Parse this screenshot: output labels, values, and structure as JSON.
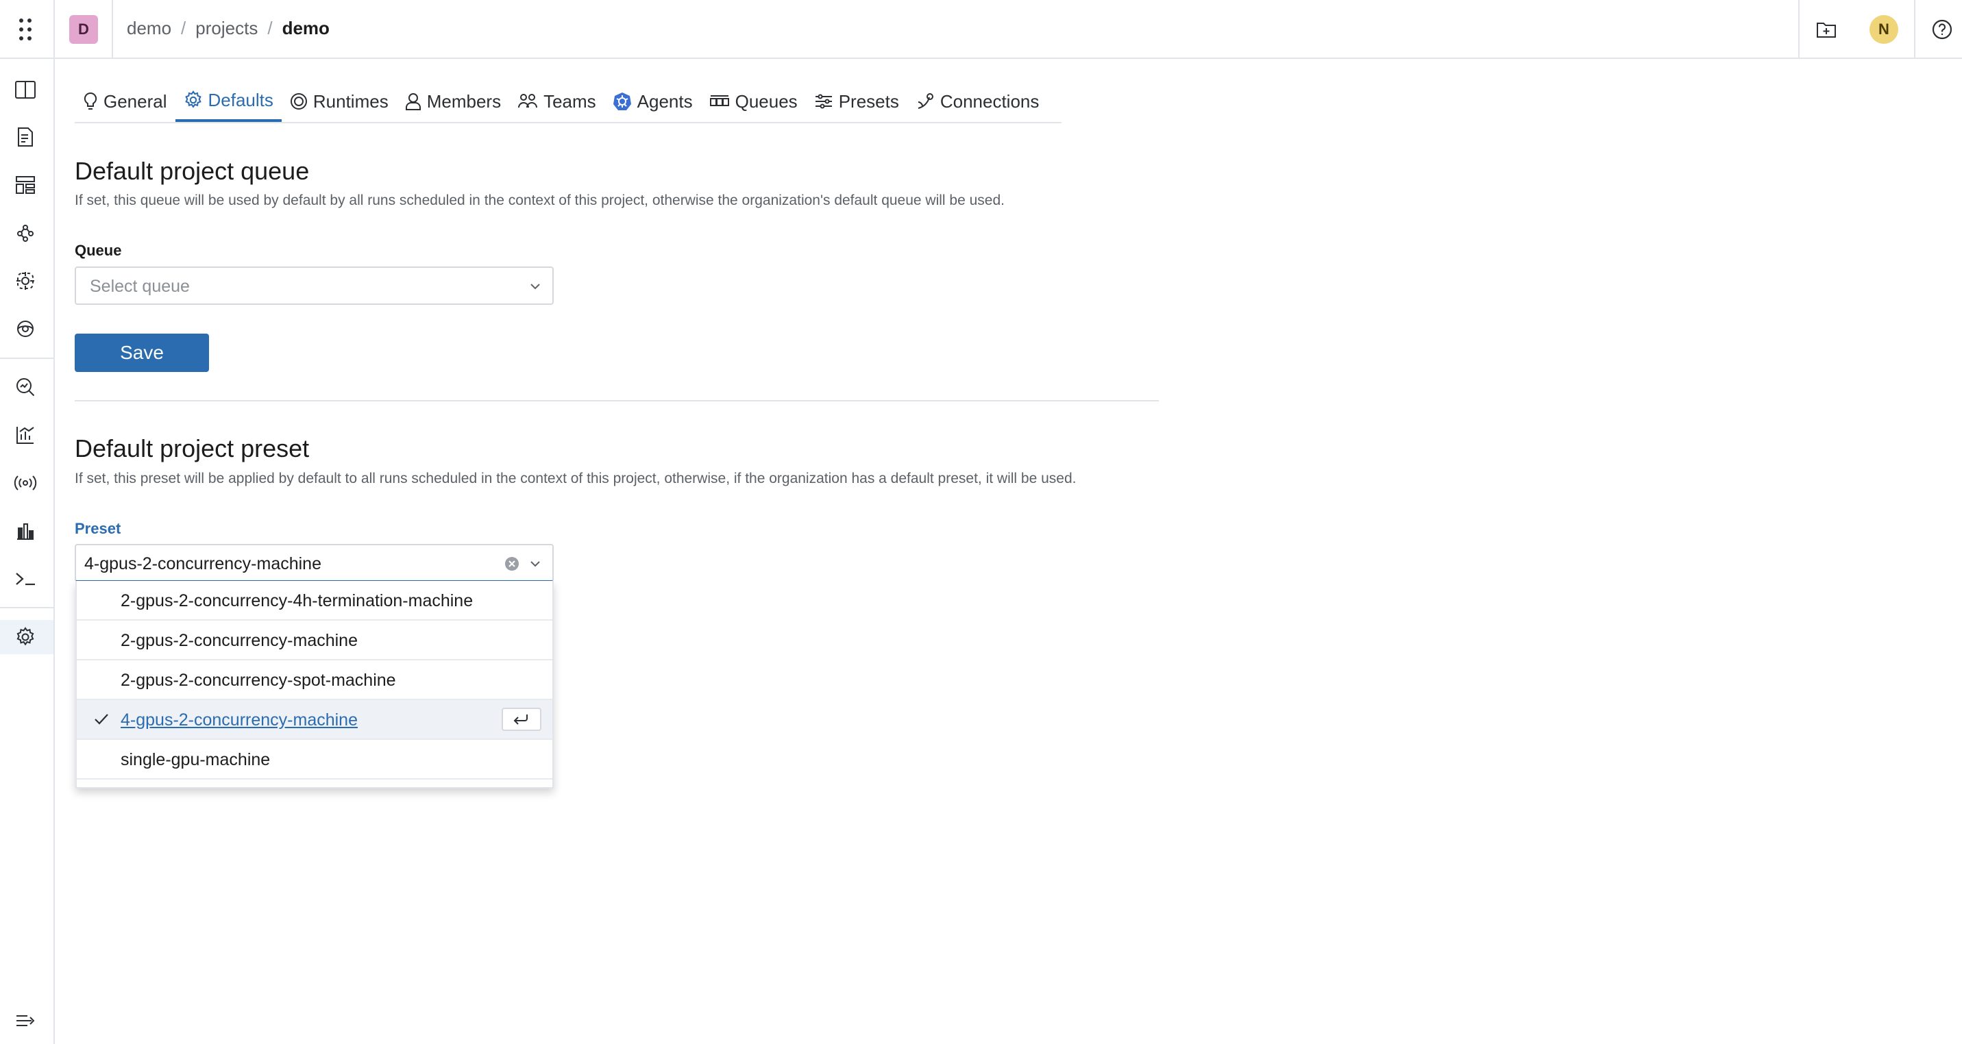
{
  "header": {
    "org_initial": "D",
    "breadcrumb": [
      "demo",
      "projects",
      "demo"
    ],
    "breadcrumb_separator": "/",
    "user_initial": "N"
  },
  "sidebar": {
    "items": [
      {
        "icon": "book-open-icon"
      },
      {
        "icon": "document-list-icon"
      },
      {
        "icon": "dashboard-layout-icon"
      },
      {
        "icon": "graph-nodes-icon"
      },
      {
        "icon": "component-icon"
      },
      {
        "icon": "eye-icon"
      },
      {
        "icon": "search-insights-icon"
      },
      {
        "icon": "chart-icon"
      },
      {
        "icon": "broadcast-icon"
      },
      {
        "icon": "chart-bars-icon"
      },
      {
        "icon": "terminal-icon"
      },
      {
        "icon": "gear-icon",
        "active": true
      }
    ],
    "collapse_icon": "collapse-sidebar-icon"
  },
  "tabs": [
    {
      "label": "General",
      "icon": "bulb-icon"
    },
    {
      "label": "Defaults",
      "icon": "gear-icon",
      "active": true
    },
    {
      "label": "Runtimes",
      "icon": "target-icon"
    },
    {
      "label": "Members",
      "icon": "user-icon"
    },
    {
      "label": "Teams",
      "icon": "users-icon"
    },
    {
      "label": "Agents",
      "icon": "kubernetes-icon"
    },
    {
      "label": "Queues",
      "icon": "queue-icon"
    },
    {
      "label": "Presets",
      "icon": "presets-icon"
    },
    {
      "label": "Connections",
      "icon": "connection-icon"
    }
  ],
  "queue_section": {
    "title": "Default project queue",
    "description": "If set, this queue will be used by default by all runs scheduled in the context of this project, otherwise the organization's default queue will be used.",
    "field_label": "Queue",
    "placeholder": "Select queue",
    "save_label": "Save"
  },
  "preset_section": {
    "title": "Default project preset",
    "description": "If set, this preset will be applied by default to all runs scheduled in the context of this project, otherwise, if the organization has a default preset, it will be used.",
    "field_label": "Preset",
    "value": "4-gpus-2-concurrency-machine",
    "options": [
      "2-gpus-2-concurrency-4h-termination-machine",
      "2-gpus-2-concurrency-machine",
      "2-gpus-2-concurrency-spot-machine",
      "4-gpus-2-concurrency-machine",
      "single-gpu-machine"
    ],
    "selected_index": 3
  },
  "colors": {
    "accent": "#2b6cb0",
    "org_avatar_bg": "#e3a6cf",
    "user_avatar_bg": "#f0d47a"
  }
}
